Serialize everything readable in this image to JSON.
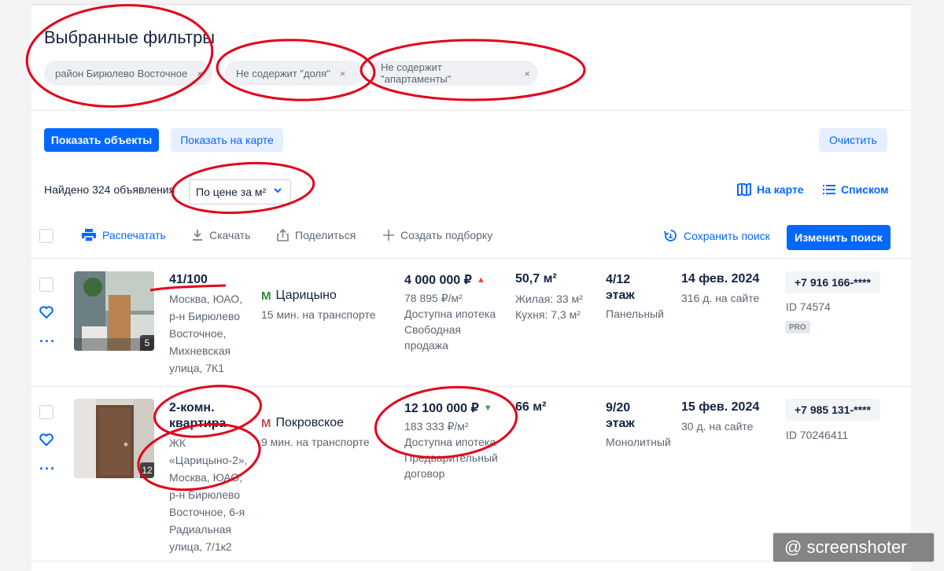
{
  "filters": {
    "title": "Выбранные фильтры",
    "chips": [
      {
        "label": "район Бирюлево Восточное",
        "remove": "×"
      },
      {
        "label": "Не содержит \"доля\"",
        "remove": "×"
      },
      {
        "label": "Не содержит \"апартаменты\"",
        "remove": "×"
      }
    ]
  },
  "actions": {
    "show_objects": "Показать объекты",
    "show_map": "Показать на карте",
    "clear": "Очистить"
  },
  "results": {
    "found": "Найдено 324 объявления",
    "sort_value": "По цене за м²",
    "view_map": "На карте",
    "view_list": "Списком"
  },
  "toolbar": {
    "print": "Распечатать",
    "download": "Скачать",
    "share": "Поделиться",
    "create_selection": "Создать подборку",
    "save_search": "Сохранить поиск",
    "edit_search": "Изменить поиск"
  },
  "listings": [
    {
      "photo_count": "5",
      "title": "41/100",
      "address": "Москва, ЮАО, р-н Бирюлево Восточное, Михневская улица, 7К1",
      "metro": "Царицыно",
      "metro_color": "#2e8b3a",
      "metro_time": "15 мин. на транспорте",
      "price": "4 000 000 ₽",
      "price_trend": "up",
      "price_trend_color": "#ff3b3b",
      "price_per_m": "78 895 ₽/м²",
      "mortgage": "Доступна ипотека",
      "sale_type": "Свободная продажа",
      "area": "50,7 м²",
      "living": "Жилая: 33 м²",
      "kitchen": "Кухня: 7,3 м²",
      "floor": "4/12",
      "floor_label": "этаж",
      "building": "Панельный",
      "date": "14 фев. 2024",
      "days": "316 д. на сайте",
      "phone": "+7 916 166-****",
      "id": "ID 74574",
      "badge": "PRO"
    },
    {
      "photo_count": "12",
      "title": "2-комн. квартира",
      "address": "ЖК «Царицыно-2», Москва, ЮАО, р-н Бирюлево Восточное, 6-я Радиальная улица, 7/1к2",
      "metro": "Покровское",
      "metro_color": "#b5525c",
      "metro_time": "9 мин. на транспорте",
      "price": "12 100 000 ₽",
      "price_trend": "down",
      "price_trend_color": "#2ea843",
      "price_per_m": "183 333 ₽/м²",
      "mortgage": "Доступна ипотека",
      "sale_type": "Предварительный договор",
      "area": "66 м²",
      "floor": "9/20",
      "floor_label": "этаж",
      "building": "Монолитный",
      "date": "15 фев. 2024",
      "days": "30 д. на сайте",
      "phone": "+7 985 131-****",
      "id": "ID 70246411"
    }
  ],
  "watermark": "@ screenshoter",
  "colors": {
    "accent": "#0468ff",
    "annotation": "#e3001b"
  }
}
